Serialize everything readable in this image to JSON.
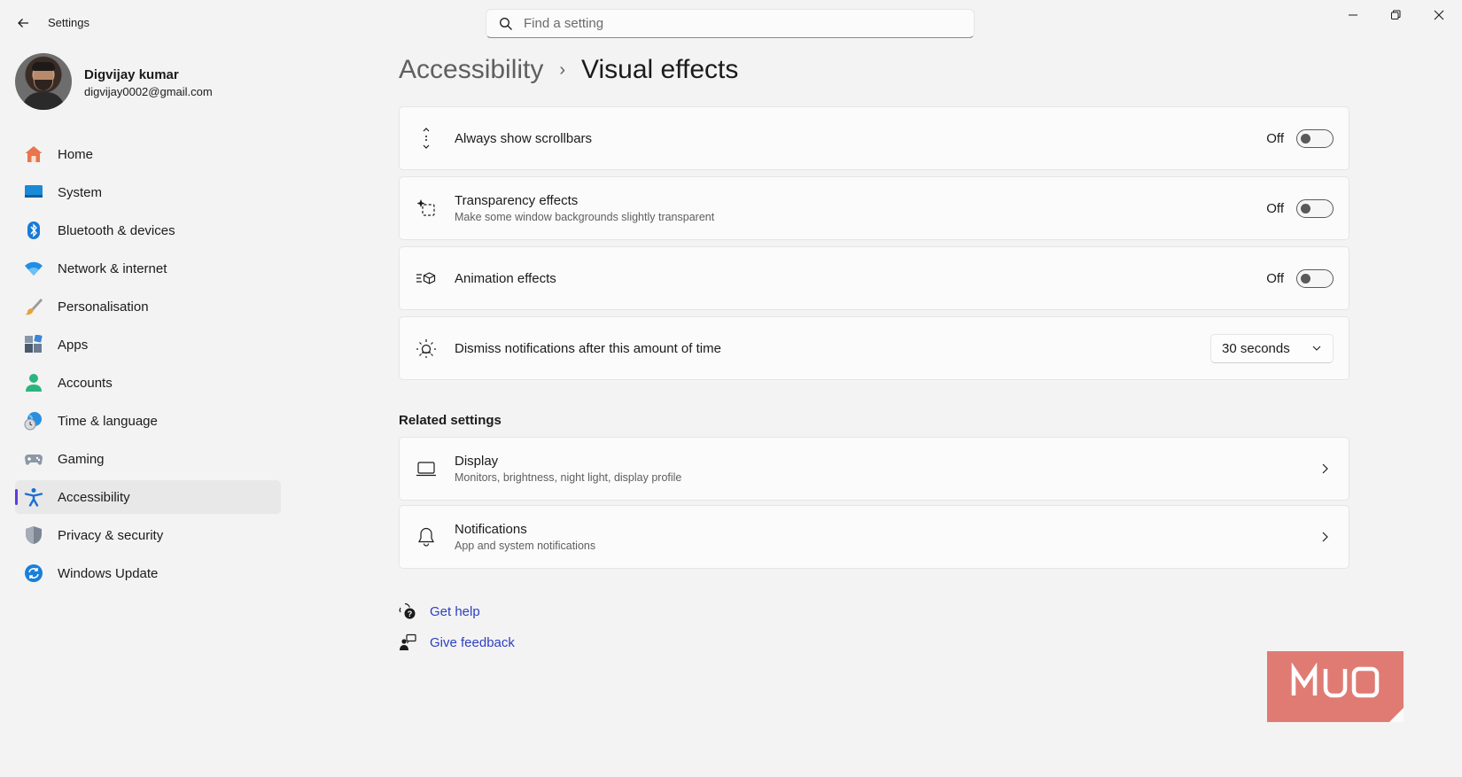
{
  "app": {
    "title": "Settings"
  },
  "search": {
    "placeholder": "Find a setting"
  },
  "profile": {
    "name": "Digvijay kumar",
    "email": "digvijay0002@gmail.com"
  },
  "sidebar": {
    "items": [
      {
        "label": "Home",
        "icon": "home-icon"
      },
      {
        "label": "System",
        "icon": "system-icon"
      },
      {
        "label": "Bluetooth & devices",
        "icon": "bluetooth-icon"
      },
      {
        "label": "Network & internet",
        "icon": "wifi-icon"
      },
      {
        "label": "Personalisation",
        "icon": "brush-icon"
      },
      {
        "label": "Apps",
        "icon": "apps-icon"
      },
      {
        "label": "Accounts",
        "icon": "person-icon"
      },
      {
        "label": "Time & language",
        "icon": "globe-clock-icon"
      },
      {
        "label": "Gaming",
        "icon": "gamepad-icon"
      },
      {
        "label": "Accessibility",
        "icon": "accessibility-icon",
        "active": true
      },
      {
        "label": "Privacy & security",
        "icon": "shield-icon"
      },
      {
        "label": "Windows Update",
        "icon": "update-icon"
      }
    ]
  },
  "breadcrumb": {
    "parent": "Accessibility",
    "separator": "›",
    "current": "Visual effects"
  },
  "settings": [
    {
      "title": "Always show scrollbars",
      "subtitle": "",
      "state": "Off",
      "icon": "scrollbar-icon"
    },
    {
      "title": "Transparency effects",
      "subtitle": "Make some window backgrounds slightly transparent",
      "state": "Off",
      "icon": "transparency-icon"
    },
    {
      "title": "Animation effects",
      "subtitle": "",
      "state": "Off",
      "icon": "animation-icon"
    },
    {
      "title": "Dismiss notifications after this amount of time",
      "subtitle": "",
      "value": "30 seconds",
      "icon": "brightness-icon"
    }
  ],
  "related": {
    "title": "Related settings",
    "items": [
      {
        "title": "Display",
        "subtitle": "Monitors, brightness, night light, display profile",
        "icon": "laptop-icon"
      },
      {
        "title": "Notifications",
        "subtitle": "App and system notifications",
        "icon": "bell-icon"
      }
    ]
  },
  "help": {
    "get_help": "Get help",
    "give_feedback": "Give feedback"
  },
  "watermark": {
    "text": "MUO"
  },
  "colors": {
    "accent": "#5b3fd6",
    "link": "#2c3fc2",
    "watermark": "#e07b74"
  }
}
